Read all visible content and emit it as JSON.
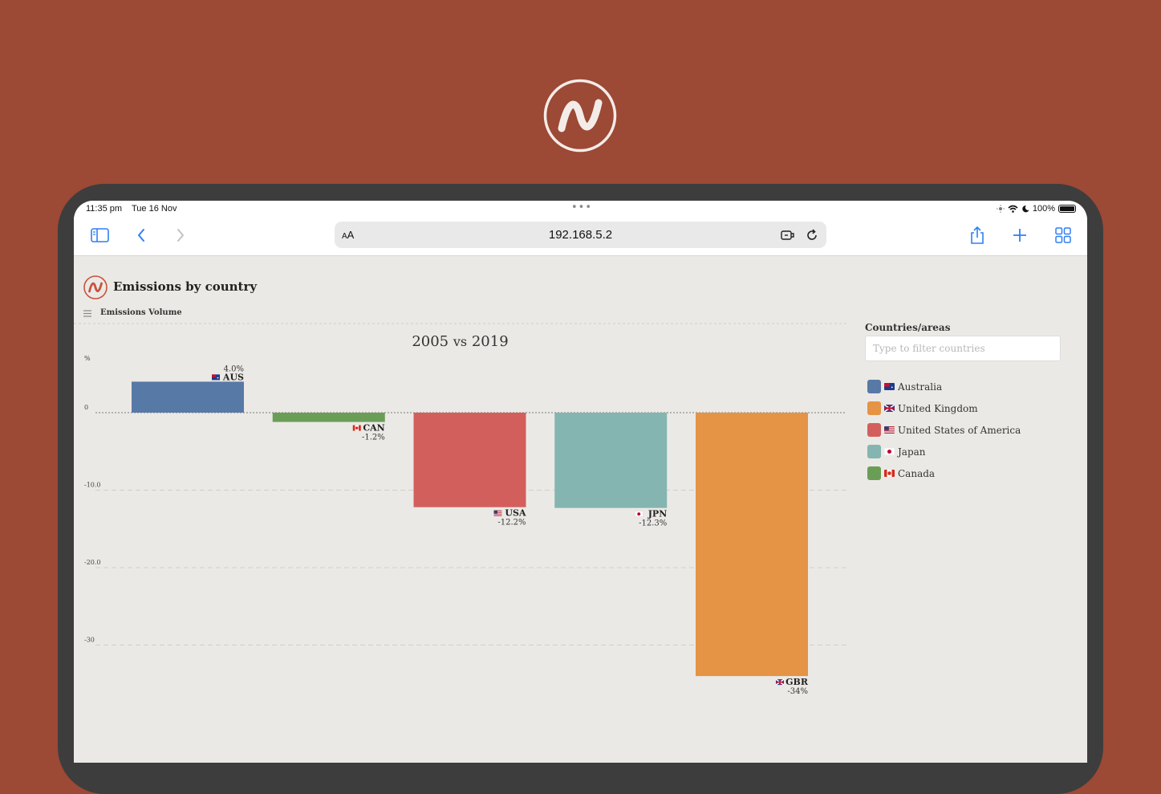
{
  "status": {
    "time": "11:35 pm",
    "date": "Tue 16 Nov",
    "battery": "100%"
  },
  "browser": {
    "text_size_small": "A",
    "text_size_large": "A",
    "url": "192.168.5.2"
  },
  "app": {
    "title": "Emissions by country",
    "subtitle": "Emissions Volume"
  },
  "chart_heading": {
    "start_year": "2005",
    "vs": "vs",
    "end_year": "2019"
  },
  "chart_data": {
    "type": "bar",
    "ylabel": "%",
    "ylim": [
      -36,
      7
    ],
    "y_ticks": [
      "0",
      "-10.0",
      "-20.0",
      "-30"
    ],
    "y_tick_values": [
      0,
      -10,
      -20,
      -30
    ],
    "grid": true,
    "categories": [
      "AUS",
      "CAN",
      "USA",
      "JPN",
      "GBR"
    ],
    "values": [
      4.0,
      -1.2,
      -12.2,
      -12.3,
      -34
    ],
    "value_labels": [
      "4.0%",
      "-1.2%",
      "-12.2%",
      "-12.3%",
      "-34%"
    ],
    "colors": [
      "#5779a6",
      "#6a9e57",
      "#d35f5d",
      "#85b5b0",
      "#e59345"
    ],
    "flags": [
      "flag-australia-icon",
      "flag-canada-icon",
      "flag-usa-icon",
      "flag-japan-icon",
      "flag-uk-icon"
    ]
  },
  "legend": {
    "title": "Countries/areas",
    "placeholder": "Type to filter countries",
    "items": [
      {
        "label": "Australia",
        "color": "#5779a6",
        "flag": "flag-australia-icon"
      },
      {
        "label": "United Kingdom",
        "color": "#e59345",
        "flag": "flag-uk-icon"
      },
      {
        "label": "United States of America",
        "color": "#d35f5d",
        "flag": "flag-usa-icon"
      },
      {
        "label": "Japan",
        "color": "#85b5b0",
        "flag": "flag-japan-icon"
      },
      {
        "label": "Canada",
        "color": "#6a9e57",
        "flag": "flag-canada-icon"
      }
    ]
  }
}
